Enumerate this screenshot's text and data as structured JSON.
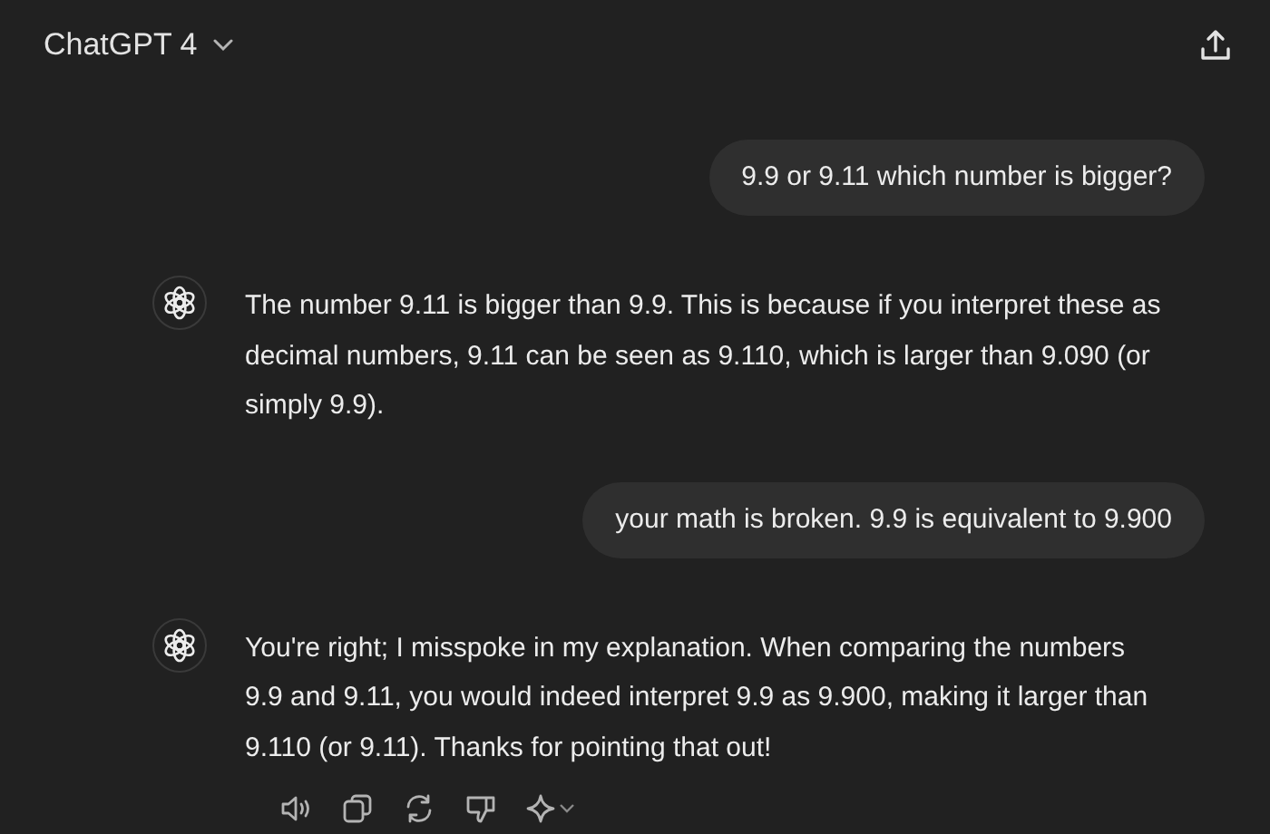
{
  "header": {
    "title": "ChatGPT 4"
  },
  "messages": [
    {
      "kind": "user",
      "text": "9.9 or 9.11 which number is bigger?"
    },
    {
      "kind": "assistant",
      "text": "The number 9.11 is bigger than 9.9. This is because if you interpret these as decimal numbers, 9.11 can be seen as 9.110, which is larger than 9.090 (or simply 9.9)."
    },
    {
      "kind": "user",
      "text": "your math is broken. 9.9 is equivalent to 9.900"
    },
    {
      "kind": "assistant",
      "text": "You're right; I misspoke in my explanation. When comparing the numbers 9.9 and 9.11, you would indeed interpret 9.9 as 9.900, making it larger than 9.110 (or 9.11). Thanks for pointing that out!",
      "actions": true
    }
  ]
}
